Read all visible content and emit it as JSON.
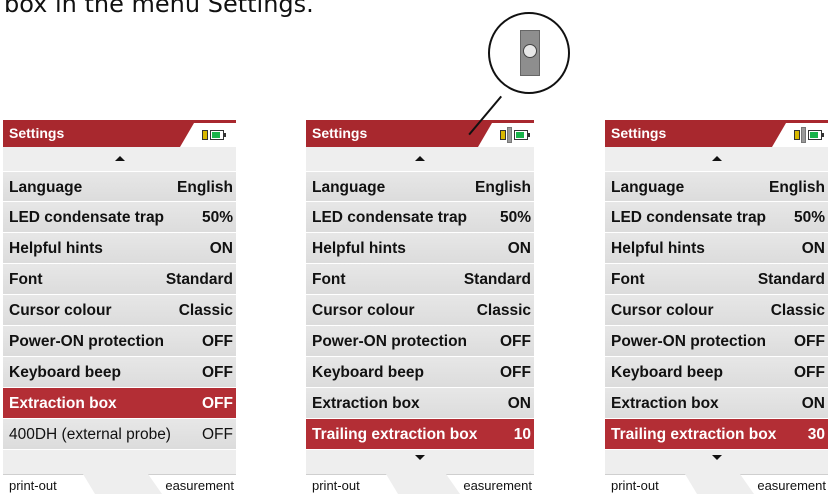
{
  "caption": "box in the menu Settings.",
  "screens": [
    {
      "title": "Settings",
      "rows": [
        {
          "label": "Language",
          "value": "English"
        },
        {
          "label": "LED condensate trap",
          "value": "50%"
        },
        {
          "label": "Helpful hints",
          "value": "ON"
        },
        {
          "label": "Font",
          "value": "Standard"
        },
        {
          "label": "Cursor colour",
          "value": "Classic"
        },
        {
          "label": "Power-ON protection",
          "value": "OFF"
        },
        {
          "label": "Keyboard beep",
          "value": "OFF"
        },
        {
          "label": "Extraction box",
          "value": "OFF"
        },
        {
          "label": "400DH (external probe)",
          "value": "OFF"
        }
      ],
      "selected_row": "Extraction box",
      "bottom_left": "print-out",
      "bottom_right": "easurement"
    },
    {
      "title": "Settings",
      "rows": [
        {
          "label": "Language",
          "value": "English"
        },
        {
          "label": "LED condensate trap",
          "value": "50%"
        },
        {
          "label": "Helpful hints",
          "value": "ON"
        },
        {
          "label": "Font",
          "value": "Standard"
        },
        {
          "label": "Cursor colour",
          "value": "Classic"
        },
        {
          "label": "Power-ON protection",
          "value": "OFF"
        },
        {
          "label": "Keyboard beep",
          "value": "OFF"
        },
        {
          "label": "Extraction box",
          "value": "ON"
        },
        {
          "label": "Trailing extraction box",
          "value": "10"
        }
      ],
      "selected_row": "Trailing extraction box",
      "bottom_left": "print-out",
      "bottom_right": "easurement"
    },
    {
      "title": "Settings",
      "rows": [
        {
          "label": "Language",
          "value": "English"
        },
        {
          "label": "LED condensate trap",
          "value": "50%"
        },
        {
          "label": "Helpful hints",
          "value": "ON"
        },
        {
          "label": "Font",
          "value": "Standard"
        },
        {
          "label": "Cursor colour",
          "value": "Classic"
        },
        {
          "label": "Power-ON protection",
          "value": "OFF"
        },
        {
          "label": "Keyboard beep",
          "value": "OFF"
        },
        {
          "label": "Extraction box",
          "value": "ON"
        },
        {
          "label": "Trailing extraction box",
          "value": "30"
        }
      ],
      "selected_row": "Trailing extraction box",
      "bottom_left": "print-out",
      "bottom_right": "easurement"
    }
  ],
  "icons": {
    "status": [
      "pump-battery-icon",
      "battery-icon",
      "extraction-box-icon"
    ],
    "scroll": [
      "scroll-up-icon",
      "scroll-down-icon"
    ],
    "callout": "extraction-box-zoom-icon"
  },
  "colors": {
    "title_bar": "#a8282e",
    "selected_row": "#b32e35",
    "row_bg": "#e2e2e2",
    "battery_green": "#19b34a",
    "battery_yellow": "#d9b800"
  }
}
